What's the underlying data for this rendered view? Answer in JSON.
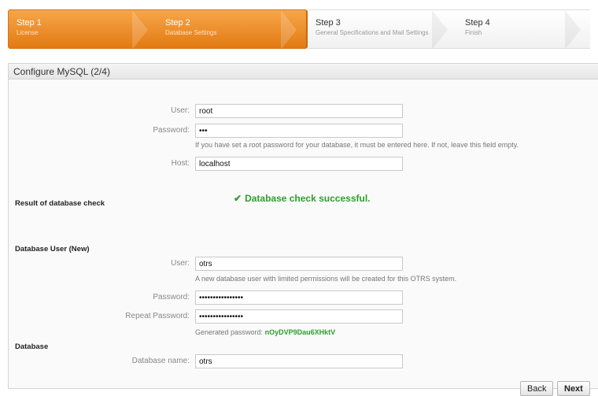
{
  "steps": [
    {
      "number": "Step 1",
      "label": "License"
    },
    {
      "number": "Step 2",
      "label": "Database Settings"
    },
    {
      "number": "Step 3",
      "label": "General Specifications and Mail Settings"
    },
    {
      "number": "Step 4",
      "label": "Finish"
    }
  ],
  "panel": {
    "title": "Configure MySQL (2/4)"
  },
  "root": {
    "user_label": "User:",
    "user_value": "root",
    "password_label": "Password:",
    "password_value": "•••",
    "password_hint": "If you have set a root password for your database, it must be entered here. If not, leave this field empty.",
    "host_label": "Host:",
    "host_value": "localhost"
  },
  "check": {
    "section_title": "Result of database check",
    "icon": "check-icon",
    "message": "Database check successful."
  },
  "new_user": {
    "section_title": "Database User (New)",
    "user_label": "User:",
    "user_value": "otrs",
    "user_hint": "A new database user with limited permissions will be created for this OTRS system.",
    "password_label": "Password:",
    "password_value": "••••••••••••••••",
    "repeat_label": "Repeat Password:",
    "repeat_value": "••••••••••••••••",
    "generated_label": "Generated password:",
    "generated_value": "nOyDVP9Dau6XHktV"
  },
  "database": {
    "section_title": "Database",
    "name_label": "Database name:",
    "name_value": "otrs"
  },
  "buttons": {
    "back": "Back",
    "next": "Next"
  },
  "colors": {
    "accent": "#e98b1e",
    "success": "#2e9e2e"
  }
}
